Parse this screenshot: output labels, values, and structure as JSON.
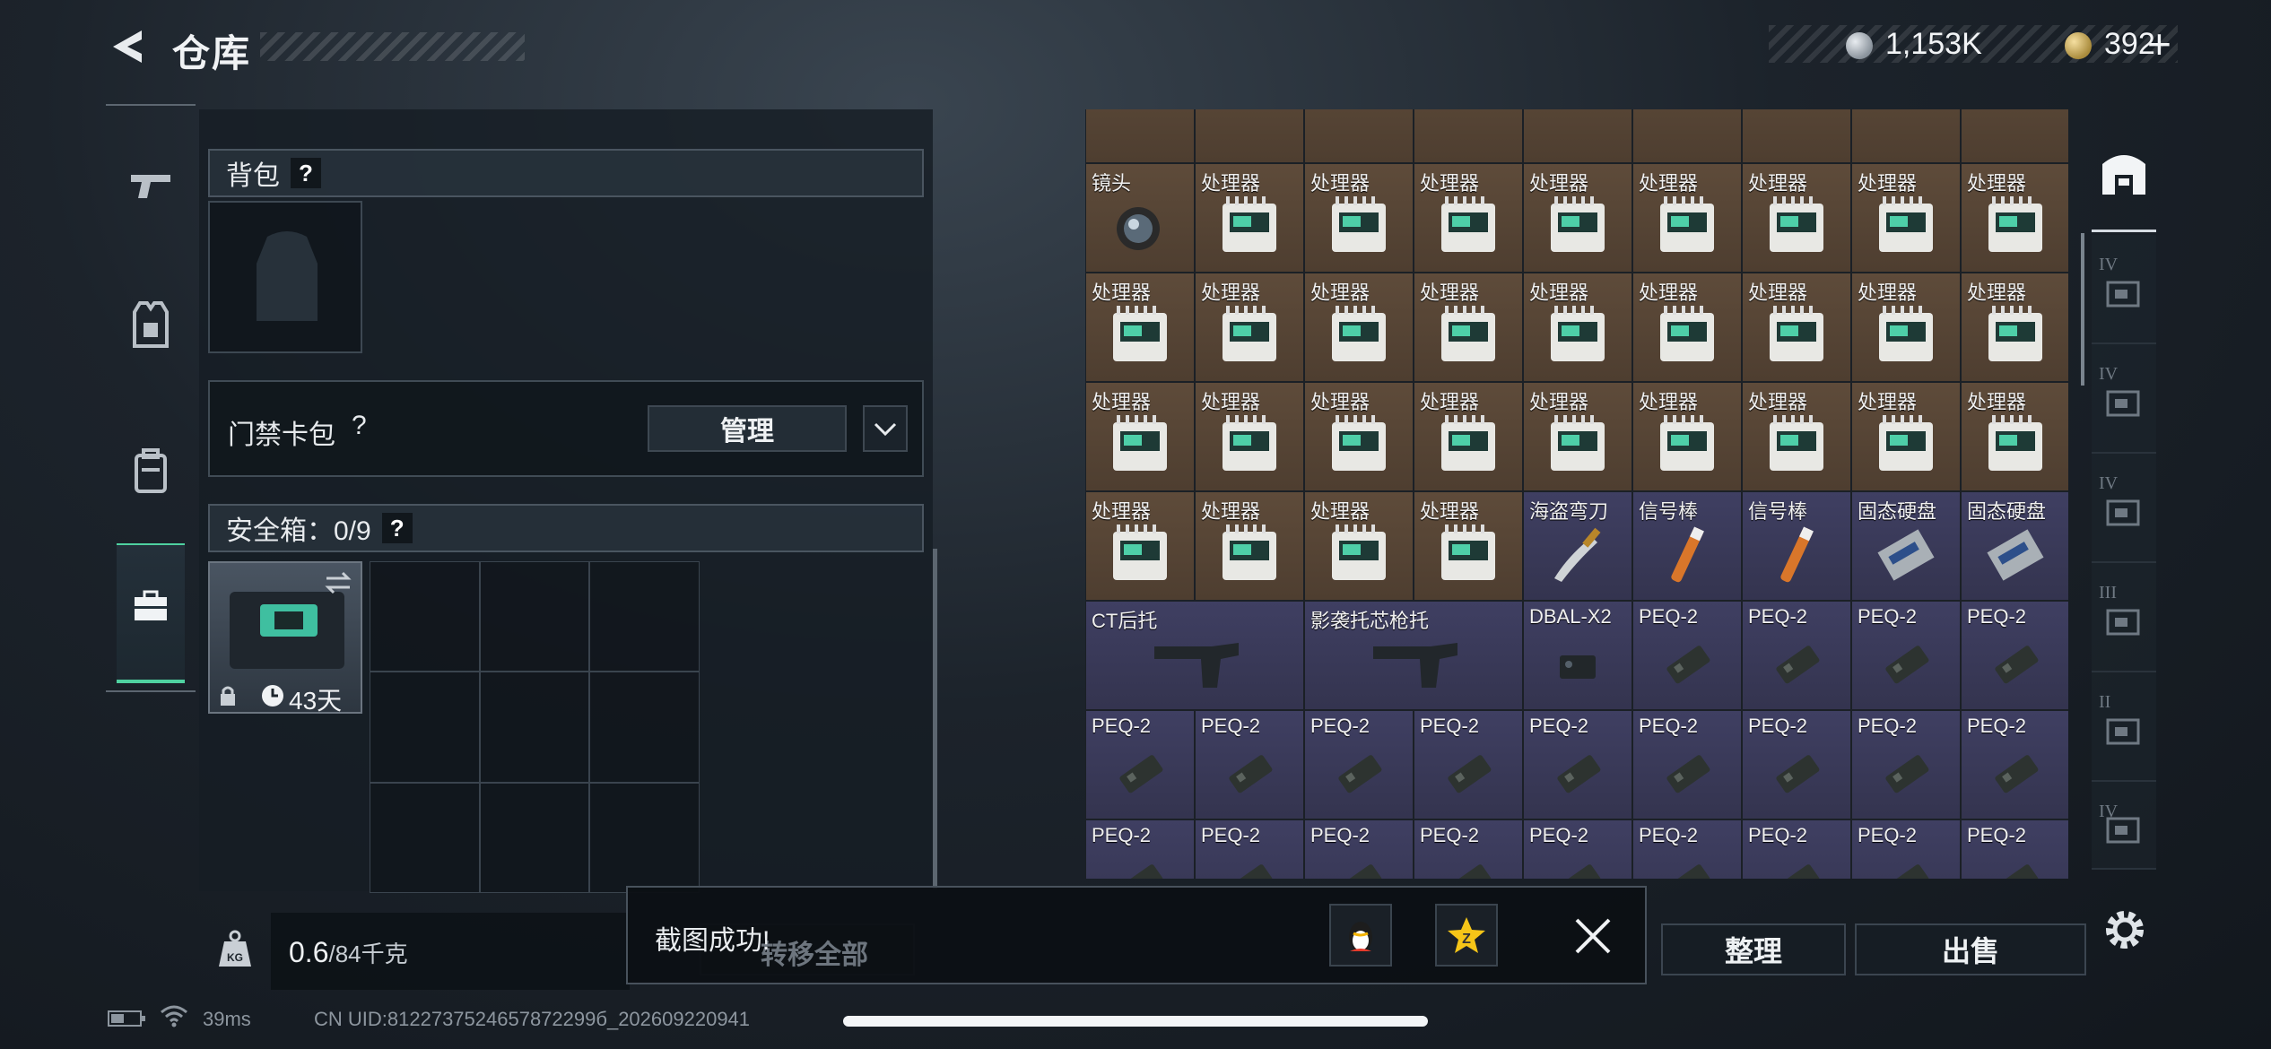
{
  "header": {
    "title": "仓库",
    "currency_silver": "1,153K",
    "currency_gold": "392",
    "add_label": "+"
  },
  "left_nav": {
    "items": [
      {
        "icon": "pistol-icon"
      },
      {
        "icon": "armor-vest-icon"
      },
      {
        "icon": "backpack-icon"
      },
      {
        "icon": "briefcase-icon"
      }
    ],
    "active_index": 3
  },
  "backpack": {
    "label": "背包",
    "help": "?"
  },
  "keycard": {
    "label": "门禁卡包",
    "help": "?",
    "manage_label": "管理"
  },
  "safebox": {
    "label": "安全箱：0/9",
    "help": "?",
    "days_left": "43天"
  },
  "weight": {
    "current": "0.6",
    "max": "/84千克"
  },
  "stash": {
    "rows": [
      [
        "",
        "",
        "",
        "",
        "",
        "",
        "",
        "",
        ""
      ],
      [
        "镜头",
        "处理器",
        "处理器",
        "处理器",
        "处理器",
        "处理器",
        "处理器",
        "处理器",
        "处理器"
      ],
      [
        "处理器",
        "处理器",
        "处理器",
        "处理器",
        "处理器",
        "处理器",
        "处理器",
        "处理器",
        "处理器"
      ],
      [
        "处理器",
        "处理器",
        "处理器",
        "处理器",
        "处理器",
        "处理器",
        "处理器",
        "处理器",
        "处理器"
      ],
      [
        "处理器",
        "处理器",
        "处理器",
        "处理器",
        "海盗弯刀",
        "信号棒",
        "信号棒",
        "固态硬盘",
        "固态硬盘"
      ],
      [
        "CT后托",
        "",
        "影袭托芯枪托",
        "",
        "DBAL-X2",
        "PEQ-2",
        "PEQ-2",
        "PEQ-2",
        "PEQ-2"
      ],
      [
        "PEQ-2",
        "PEQ-2",
        "PEQ-2",
        "PEQ-2",
        "PEQ-2",
        "PEQ-2",
        "PEQ-2",
        "PEQ-2",
        "PEQ-2"
      ],
      [
        "PEQ-2",
        "PEQ-2",
        "PEQ-2",
        "PEQ-2",
        "PEQ-2",
        "PEQ-2",
        "PEQ-2",
        "PEQ-2",
        "PEQ-2"
      ]
    ]
  },
  "actions": {
    "transfer_all": "转移全部",
    "sort": "整理",
    "sell": "出售"
  },
  "toast": {
    "message": "截图成功!"
  },
  "right_tabs": {
    "tier_labels": [
      "IV",
      "IV",
      "IV",
      "III",
      "II",
      "IV"
    ]
  },
  "status_bar": {
    "ping": "39ms",
    "uid": "CN UID:8122737524657872299б_202609220941"
  },
  "colors": {
    "accent": "#4fd1a0",
    "brown_cell": "#5a4838",
    "purple_cell": "#3b3b5c"
  }
}
